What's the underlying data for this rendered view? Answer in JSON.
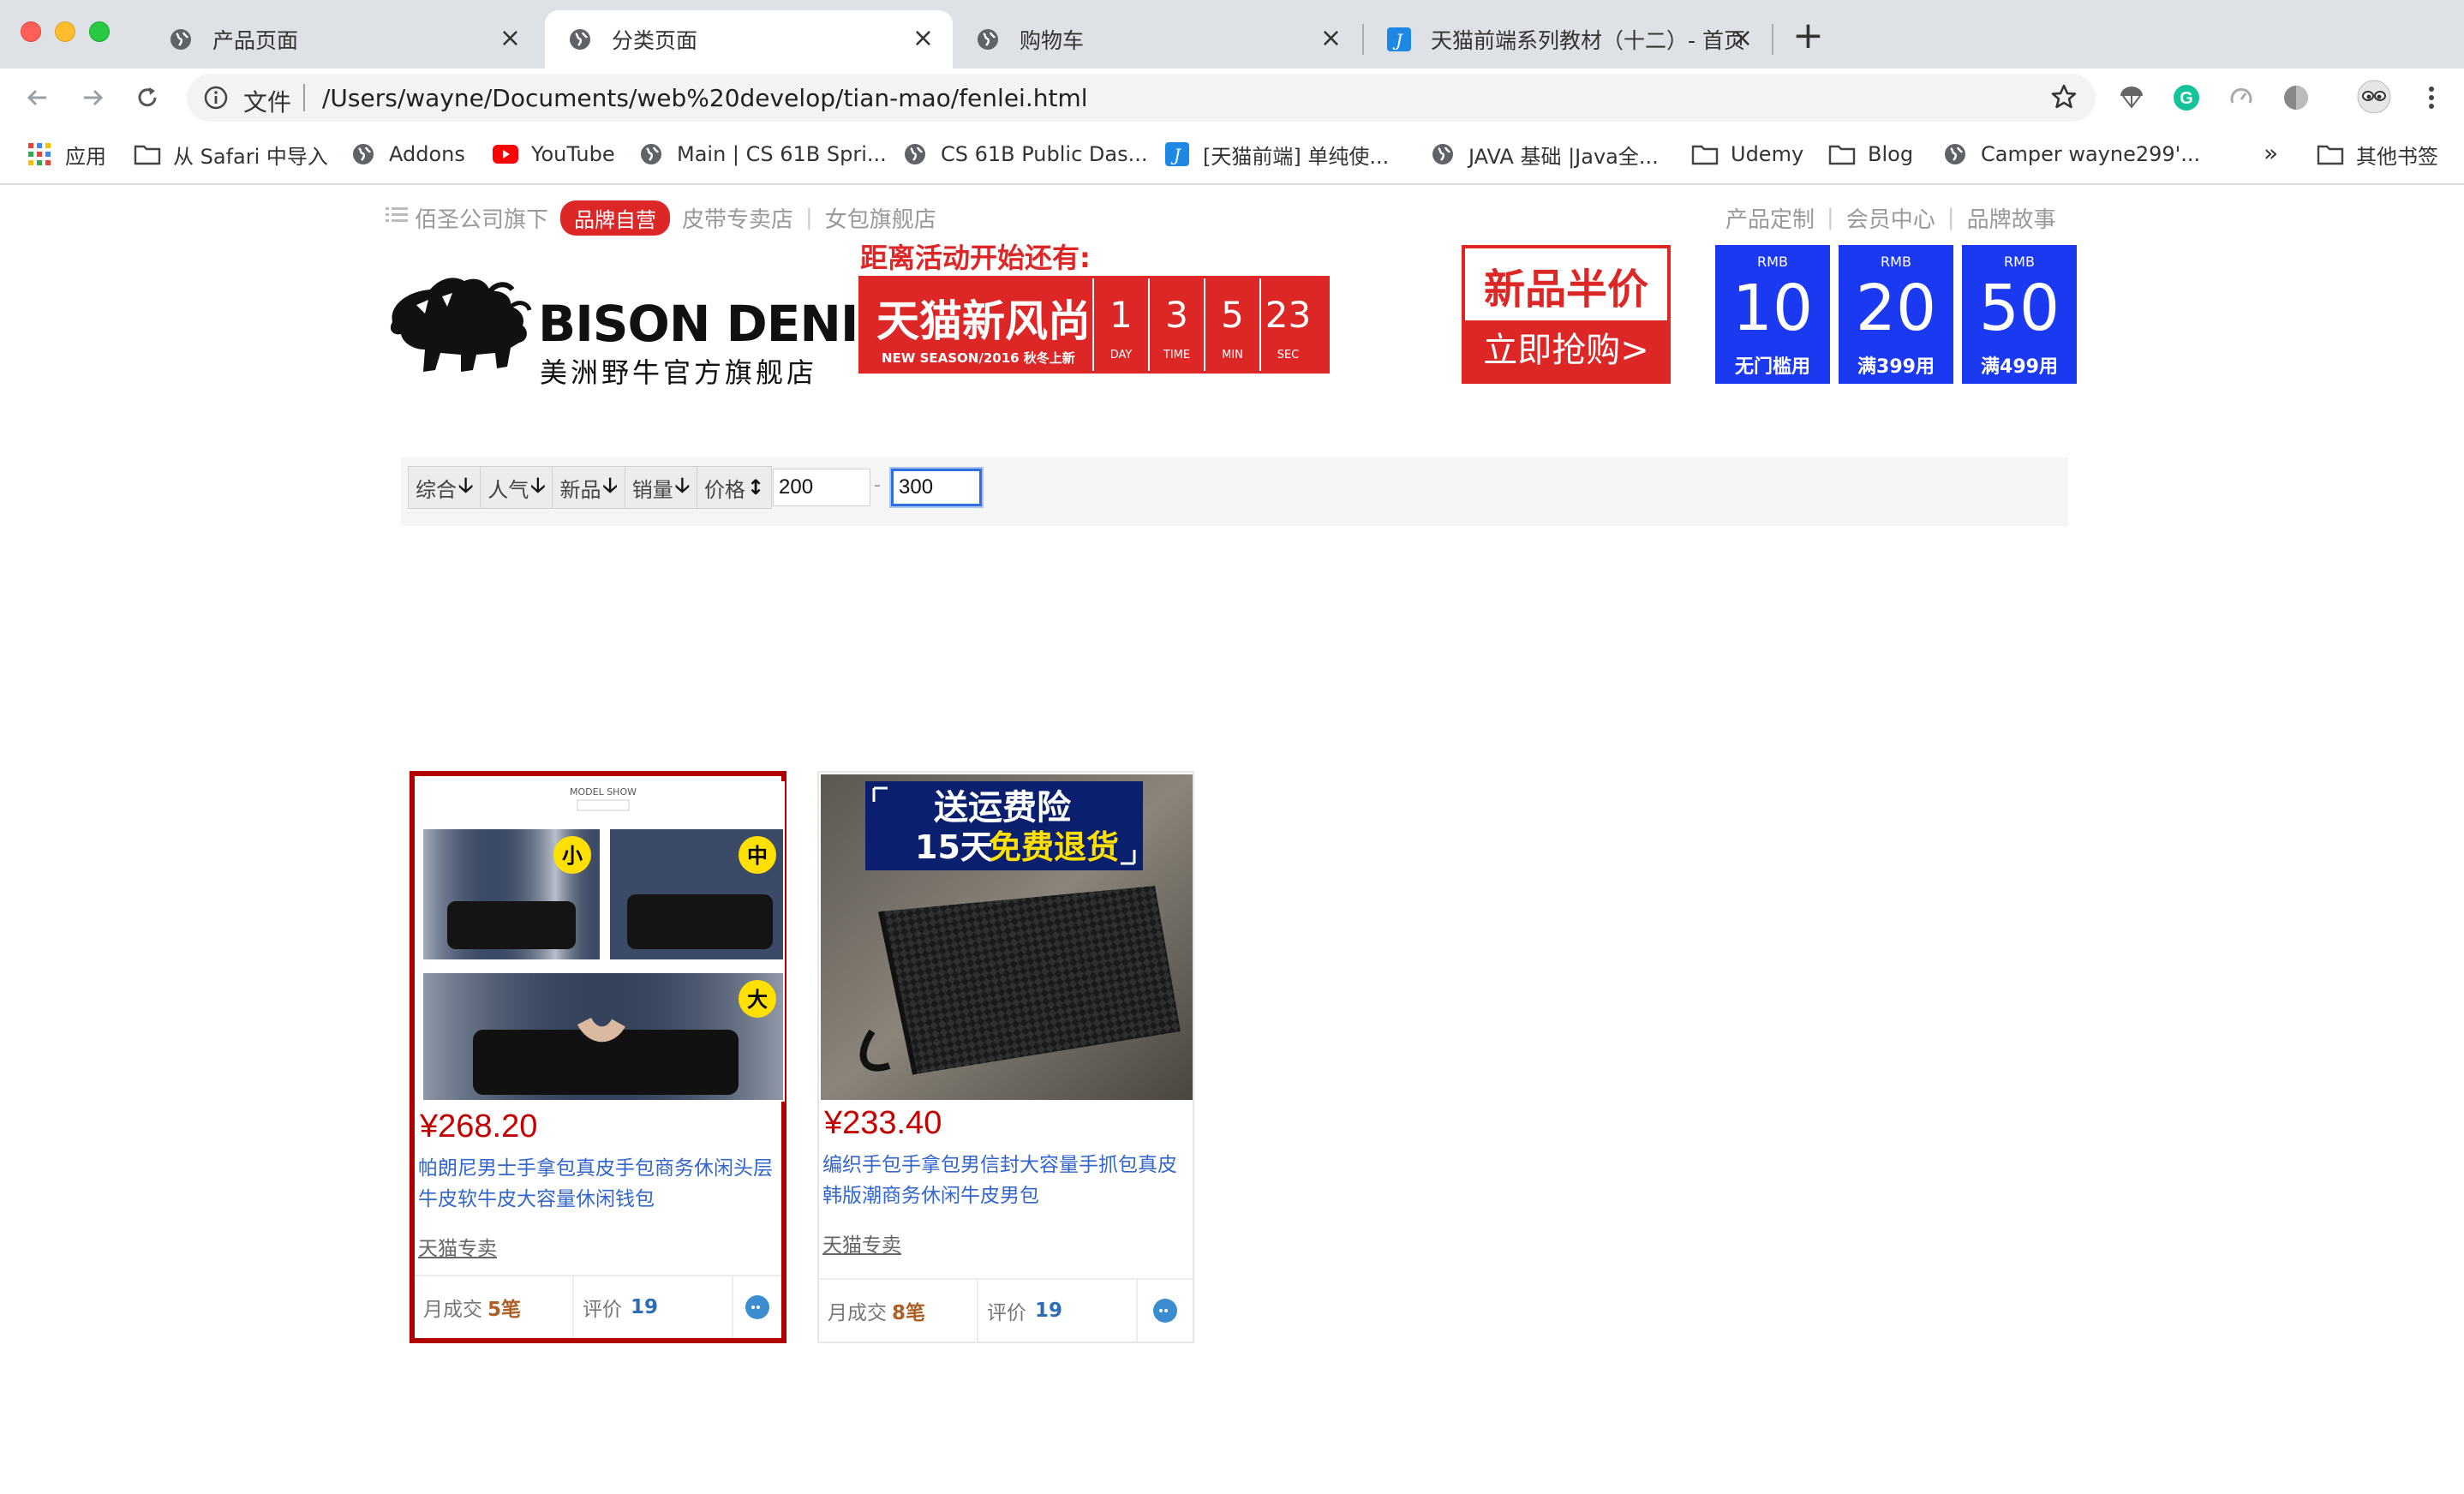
{
  "browser": {
    "tabs": [
      {
        "title": "产品页面",
        "active": false
      },
      {
        "title": "分类页面",
        "active": true
      },
      {
        "title": "购物车",
        "active": false
      },
      {
        "title": "天猫前端系列教材（十二）- 首页",
        "active": false
      }
    ],
    "close_glyph": "×",
    "new_tab_glyph": "+",
    "omnibox": {
      "scheme_label": "文件",
      "url": "/Users/wayne/Documents/web%20develop/tian-mao/fenlei.html"
    },
    "bookmarks": [
      {
        "label": "应用",
        "icon": "apps-grid-icon"
      },
      {
        "label": "从 Safari 中导入",
        "icon": "folder-icon"
      },
      {
        "label": "Addons",
        "icon": "globe-icon"
      },
      {
        "label": "YouTube",
        "icon": "youtube-icon"
      },
      {
        "label": "Main | CS 61B Spri...",
        "icon": "globe-icon"
      },
      {
        "label": "CS 61B Public Das...",
        "icon": "globe-icon"
      },
      {
        "label": "[天猫前端] 单纯使...",
        "icon": "j-site-icon"
      },
      {
        "label": "JAVA 基础 |Java全...",
        "icon": "globe-icon"
      },
      {
        "label": "Udemy",
        "icon": "folder-icon"
      },
      {
        "label": "Blog",
        "icon": "folder-icon"
      },
      {
        "label": "Camper wayne299'...",
        "icon": "globe-icon"
      },
      {
        "label": "其他书签",
        "icon": "folder-icon"
      }
    ],
    "bookmarks_more": "»"
  },
  "header": {
    "company_prefix": "佰圣公司旗下",
    "brand_badge": "品牌自营",
    "nav_left": [
      "皮带专卖店",
      "女包旗舰店"
    ],
    "nav_right": [
      "产品定制",
      "会员中心",
      "品牌故事"
    ],
    "separator": "|",
    "logo_name": "BISON DENIM",
    "logo_subtitle": "美洲野牛官方旗舰店"
  },
  "countdown": {
    "title": "距离活动开始还有:",
    "brand_text": "天猫新风尚",
    "brand_sub": "NEW SEASON/2016 秋冬上新",
    "cells": [
      {
        "value": "1",
        "label": "DAY"
      },
      {
        "value": "3",
        "label": "TIME"
      },
      {
        "value": "5",
        "label": "MIN"
      },
      {
        "value": "23",
        "label": "SEC"
      }
    ]
  },
  "promo": {
    "top": "新品半价",
    "bottom": "立即抢购>"
  },
  "coupons": [
    {
      "currency": "RMB",
      "amount": "10",
      "condition": "无门槛用"
    },
    {
      "currency": "RMB",
      "amount": "20",
      "condition": "满399用"
    },
    {
      "currency": "RMB",
      "amount": "50",
      "condition": "满499用"
    }
  ],
  "sort_bar": {
    "options": [
      {
        "label": "综合",
        "arrow": "🡣"
      },
      {
        "label": "人气",
        "arrow": "🡣"
      },
      {
        "label": "新品",
        "arrow": "🡣"
      },
      {
        "label": "销量",
        "arrow": "🡣"
      },
      {
        "label": "价格",
        "arrow": "↕"
      }
    ],
    "price_min": "200",
    "price_max": "300",
    "price_dash": "-"
  },
  "products": [
    {
      "price": "¥268.20",
      "title": "帕朗尼男士手拿包真皮手包商务休闲头层牛皮软牛皮大容量休闲钱包",
      "shop": "天猫专卖",
      "sales_label": "月成交",
      "sales_value": "5笔",
      "review_label": "评价",
      "review_value": "19",
      "image_caption": "MODEL SHOW",
      "size_badges": [
        "小",
        "中",
        "大"
      ]
    },
    {
      "price": "¥233.40",
      "title": "编织手包手拿包男信封大容量手抓包真皮韩版潮商务休闲牛皮男包",
      "shop": "天猫专卖",
      "sales_label": "月成交",
      "sales_value": "8笔",
      "review_label": "评价",
      "review_value": "19",
      "banner_line1": "送运费险",
      "banner_line2_a": "15天",
      "banner_line2_b": "免费退货"
    }
  ],
  "colors": {
    "tmall_red": "#dd2727",
    "price_red": "#c40000",
    "coupon_blue": "#1c39f2",
    "link_blue": "#3366cc",
    "highlight_border": "#b10000"
  }
}
